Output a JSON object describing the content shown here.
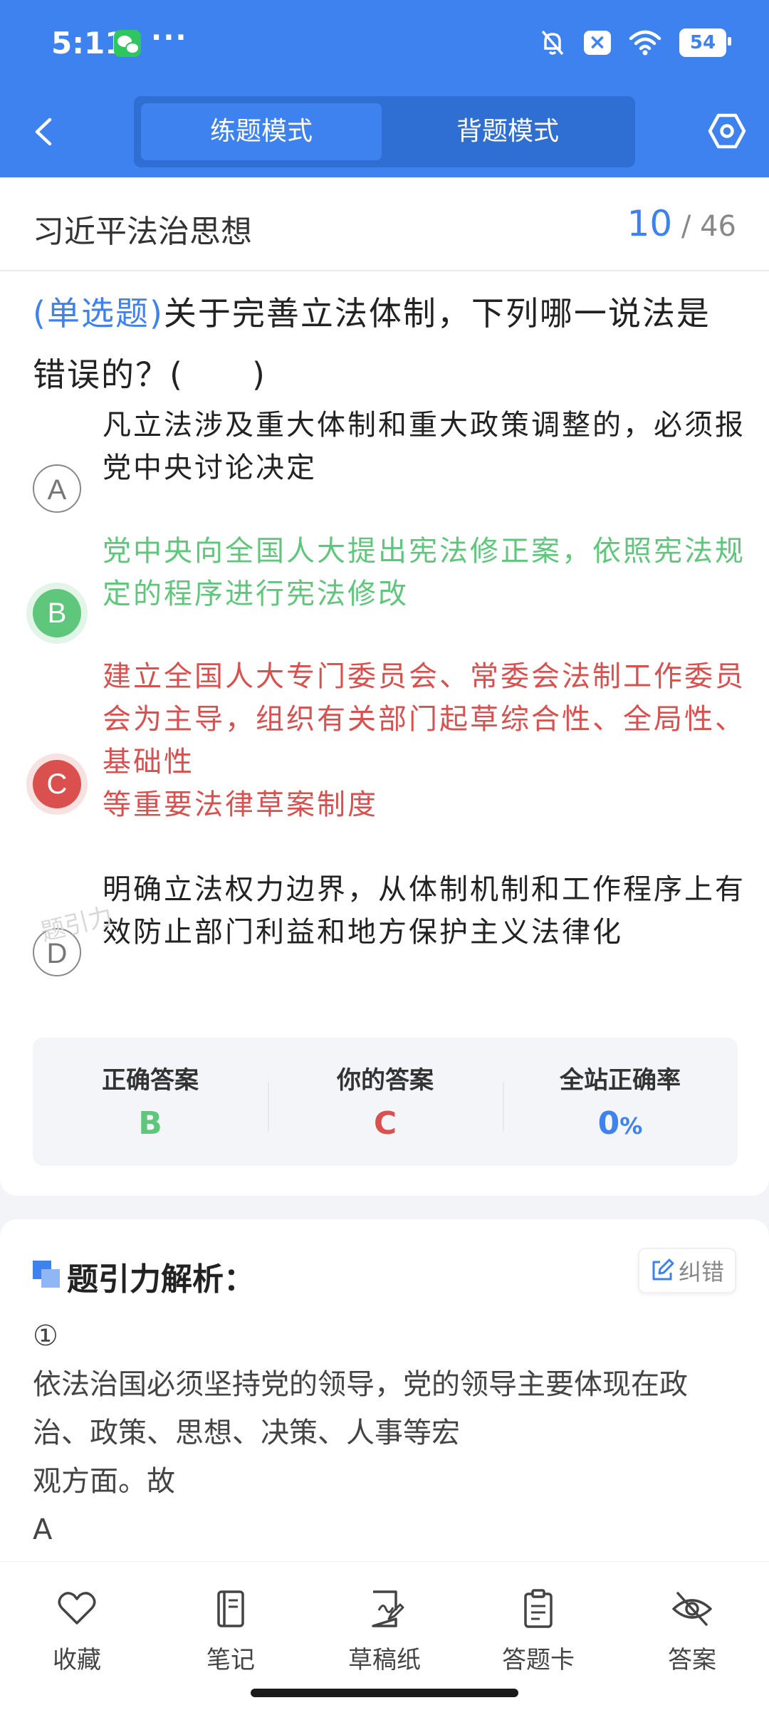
{
  "status_bar": {
    "time": "5:11",
    "more": "···",
    "battery": "54"
  },
  "header": {
    "mode_tabs": [
      {
        "label": "练题模式",
        "active": true
      },
      {
        "label": "背题模式",
        "active": false
      }
    ]
  },
  "subject": {
    "title": "习近平法治思想",
    "current": "10",
    "total": "/ 46"
  },
  "question": {
    "type": "(单选题)",
    "text": "关于完善立法体制，下列哪一说法是错误的？(　　)"
  },
  "options": [
    {
      "letter": "A",
      "state": "normal",
      "text": "凡立法涉及重大体制和重大政策调整的，必须报党中央讨论决定"
    },
    {
      "letter": "B",
      "state": "correct",
      "text": "党中央向全国人大提出宪法修正案，依照宪法规定的程序进行宪法修改"
    },
    {
      "letter": "C",
      "state": "wrong",
      "line1": "建立全国人大专门委员会、常委会法制工作委员会为主导，组织有关部门起草综合性、全局性、基础性",
      "line2": "等重要法律草案制度"
    },
    {
      "letter": "D",
      "state": "normal",
      "text": "明确立法权力边界，从体制机制和工作程序上有效防止部门利益和地方保护主义法律化"
    }
  ],
  "watermark": "题引力",
  "stats": {
    "correct_label": "正确答案",
    "correct_value": "B",
    "yours_label": "你的答案",
    "yours_value": "C",
    "rate_label": "全站正确率",
    "rate_value": "0",
    "rate_unit": "%"
  },
  "analysis": {
    "title": "题引力解析：",
    "report_label": "纠错",
    "marker": "①",
    "line1": "依法治国必须坚持党的领导，党的领导主要体现在政治、政策、思想、决策、人事等宏",
    "line2": "观方面。故",
    "line3": "A"
  },
  "toolbar": [
    {
      "label": "收藏",
      "icon": "heart-icon"
    },
    {
      "label": "笔记",
      "icon": "notebook-icon"
    },
    {
      "label": "草稿纸",
      "icon": "draft-paper-icon"
    },
    {
      "label": "答题卡",
      "icon": "answer-sheet-icon"
    },
    {
      "label": "答案",
      "icon": "eye-off-icon"
    }
  ],
  "colors": {
    "primary": "#3d82ee",
    "correct": "#5fc77c",
    "wrong": "#d9504f"
  }
}
